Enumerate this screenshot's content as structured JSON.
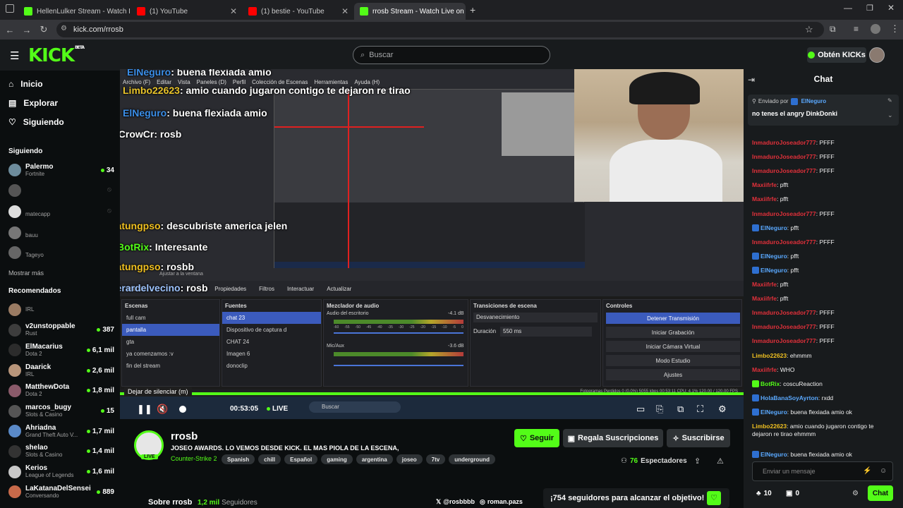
{
  "browser": {
    "tabs": [
      {
        "title": "HellenLulker Stream - Watch Li",
        "fav_color": "#53fc18",
        "active": false
      },
      {
        "title": "(1) YouTube",
        "fav_color": "#ff0000",
        "active": false
      },
      {
        "title": "(1) bestie - YouTube",
        "fav_color": "#ff0000",
        "active": false
      },
      {
        "title": "rrosb Stream - Watch Live on K",
        "fav_color": "#53fc18",
        "active": true
      }
    ],
    "url": "kick.com/rrosb"
  },
  "header": {
    "logo": "KICK",
    "beta": "BETA",
    "search_placeholder": "Buscar",
    "kicks_button": "Obtén KICKs"
  },
  "sidebar": {
    "nav": [
      "Inicio",
      "Explorar",
      "Siguiendo"
    ],
    "following_title": "Siguiendo",
    "following": [
      {
        "name": "Palermo",
        "game": "Fortnite",
        "viewers": "34",
        "color": "#6d8c9c"
      },
      {
        "name": "",
        "game": "",
        "viewers": "",
        "color": "#555"
      },
      {
        "name": "",
        "game": "matecapp",
        "viewers": "",
        "color": "#ddd"
      },
      {
        "name": "",
        "game": "bauu",
        "viewers": "",
        "color": "#777"
      },
      {
        "name": "",
        "game": "Tageyo",
        "viewers": "",
        "color": "#666"
      }
    ],
    "show_more": "Mostrar más",
    "recommended_title": "Recomendados",
    "recommended": [
      {
        "name": "",
        "game": "IRL",
        "viewers": "",
        "color": "#9a7b63"
      },
      {
        "name": "v2unstoppable",
        "game": "Rust",
        "viewers": "387",
        "color": "#3d3d3d"
      },
      {
        "name": "ElMacarius",
        "game": "Dota 2",
        "viewers": "6,1 mil",
        "color": "#2c2c2c"
      },
      {
        "name": "Daarick",
        "game": "IRL",
        "viewers": "2,6 mil",
        "color": "#b8957a"
      },
      {
        "name": "MatthewDota",
        "game": "Dota 2",
        "viewers": "1,8 mil",
        "color": "#8a5a6a"
      },
      {
        "name": "marcos_bugy",
        "game": "Slots & Casino",
        "viewers": "15",
        "color": "#555"
      },
      {
        "name": "Ahriadna",
        "game": "Grand Theft Auto V...",
        "viewers": "1,7 mil",
        "color": "#5a8ac8"
      },
      {
        "name": "shelao",
        "game": "Slots & Casino",
        "viewers": "1,4 mil",
        "color": "#333"
      },
      {
        "name": "Kerios",
        "game": "League of Legends",
        "viewers": "1,6 mil",
        "color": "#c8c8c8"
      },
      {
        "name": "LaKatanaDelSensei",
        "game": "Conversando",
        "viewers": "889",
        "color": "#c86a4a"
      }
    ]
  },
  "video": {
    "overlay_chat": [
      {
        "user": "ElNeguro",
        "text": "buena flexiada amio",
        "color": "#3b8ee8"
      },
      {
        "user": "Limbo22623",
        "text": "amio cuando jugaron contigo te dejaron re tirao",
        "color": "#e8c32a"
      },
      {
        "user": "ElNeguro",
        "text": "buena flexiada amio",
        "color": "#3b8ee8"
      },
      {
        "user": "xCrowCr",
        "text": "rosb",
        "color": "#ffffff"
      },
      {
        "user": "batungpso",
        "text": "descubriste america jelen",
        "color": "#f0c020"
      },
      {
        "user": "BotRix",
        "text": "Interesante",
        "color": "#53fc18"
      },
      {
        "user": "batungpso",
        "text": "rosbb",
        "color": "#f0c020"
      },
      {
        "user": "gerardelvecino",
        "text": "rosb",
        "color": "#9ec4ff"
      }
    ],
    "obs": {
      "menu": [
        "Archivo (F)",
        "Editar",
        "Vista",
        "Paneles (D)",
        "Perfil",
        "Colección de Escenas",
        "Herramientas",
        "Ayuda (H)"
      ],
      "zoom_label": "Ajustar a la ventana",
      "toolbar": [
        "chat 23",
        "Propiedades",
        "Filtros",
        "Interactuar",
        "Actualizar"
      ],
      "scenes_title": "Escenas",
      "scenes": [
        "full cam",
        "pantalla",
        "gta",
        "ya comenzamos :v",
        "fin del stream"
      ],
      "sources_title": "Fuentes",
      "sources": [
        "chat 23",
        "Dispositivo de captura d",
        "CHAT 24",
        "Imagen 6",
        "donoclip"
      ],
      "mixer_title": "Mezclador de audio",
      "mixer": [
        {
          "name": "Audio del escritorio",
          "db": "-4.1 dB"
        },
        {
          "name": "Mic/Aux",
          "db": "-3.6 dB"
        }
      ],
      "mixer_ticks": [
        "-60",
        "-55",
        "-50",
        "-45",
        "-40",
        "-35",
        "-30",
        "-25",
        "-20",
        "-15",
        "-10",
        "-5",
        "0"
      ],
      "transitions_title": "Transiciones de escena",
      "transition_value": "Desvanecimiento",
      "duration_label": "Duración",
      "duration_value": "550 ms",
      "controls_title": "Controles",
      "controls": [
        "Detener Transmisión",
        "Iniciar Grabación",
        "Iniciar Cámara Virtual",
        "Modo Estudio",
        "Ajustes"
      ],
      "status": "Fotogramas Perdidos 0 (0.0%)   5055 kbps   00:53:11   CPU: 4.1%   120.00 / 120.00 FPS",
      "taskbar_search": "Buscar"
    }
  },
  "player": {
    "tooltip": "Dejar de silenciar (m)",
    "time": "00:53:05",
    "live": "LIVE"
  },
  "stream": {
    "channel": "rrosb",
    "title": "JOSEO AWARDS. LO VEMOS DESDE KICK. EL MAS PIOLA DE LA ESCENA,",
    "category": "Counter-Strike 2",
    "tags": [
      "Spanish",
      "chill",
      "Español",
      "gaming",
      "argentina",
      "joseo",
      "7tv",
      "underground"
    ],
    "follow": "Seguir",
    "gift_subs": "Regala Suscripciones",
    "subscribe": "Suscribirse",
    "viewers_count": "76",
    "viewers_label": "Espectadores",
    "about": "Sobre rrosb",
    "followers_count": "1,2 mil",
    "followers_label": "Seguidores",
    "x_handle": "@rosbbbb",
    "ig_handle": "roman.pazs",
    "goal": "¡754 seguidores para alcanzar el objetivo!",
    "live_badge": "LIVE"
  },
  "chat": {
    "title": "Chat",
    "pinned_label": "Enviado por",
    "pinned_user": "ElNeguro",
    "pinned_text": "no tenes el angry DinkDonki",
    "messages": [
      {
        "user": "InmaduroJoseador777",
        "text": "PFFF",
        "color": "#e0303a",
        "badge": ""
      },
      {
        "user": "InmaduroJoseador777",
        "text": "PFFF",
        "color": "#e0303a",
        "badge": ""
      },
      {
        "user": "InmaduroJoseador777",
        "text": "PFFF",
        "color": "#e0303a",
        "badge": ""
      },
      {
        "user": "Maxiifrfe",
        "text": "pfft",
        "color": "#e0303a",
        "badge": ""
      },
      {
        "user": "Maxiifrfe",
        "text": "pfft",
        "color": "#e0303a",
        "badge": ""
      },
      {
        "user": "InmaduroJoseador777",
        "text": "PFFF",
        "color": "#e0303a",
        "badge": ""
      },
      {
        "user": "ElNeguro",
        "text": "pfft",
        "color": "#5aa9ff",
        "badge": "#2e6fd0"
      },
      {
        "user": "InmaduroJoseador777",
        "text": "PFFF",
        "color": "#e0303a",
        "badge": ""
      },
      {
        "user": "ElNeguro",
        "text": "pfft",
        "color": "#5aa9ff",
        "badge": "#2e6fd0"
      },
      {
        "user": "ElNeguro",
        "text": "pfft",
        "color": "#5aa9ff",
        "badge": "#2e6fd0"
      },
      {
        "user": "Maxiifrfe",
        "text": "pfft",
        "color": "#e0303a",
        "badge": ""
      },
      {
        "user": "Maxiifrfe",
        "text": "pfft",
        "color": "#e0303a",
        "badge": ""
      },
      {
        "user": "InmaduroJoseador777",
        "text": "PFFF",
        "color": "#e0303a",
        "badge": ""
      },
      {
        "user": "InmaduroJoseador777",
        "text": "PFFF",
        "color": "#e0303a",
        "badge": ""
      },
      {
        "user": "InmaduroJoseador777",
        "text": "PFFF",
        "color": "#e0303a",
        "badge": ""
      },
      {
        "user": "Limbo22623",
        "text": "ehmmm",
        "color": "#f0c020",
        "badge": ""
      },
      {
        "user": "Maxiifrfe",
        "text": "WHO",
        "color": "#e0303a",
        "badge": ""
      },
      {
        "user": "BotRix",
        "text": "coscuReaction",
        "color": "#53fc18",
        "badge": "#53fc18"
      },
      {
        "user": "HolaBanaSoyAyrton",
        "text": "rxdd",
        "color": "#5aa9ff",
        "badge": "#2e6fd0"
      },
      {
        "user": "ElNeguro",
        "text": "buena flexiada amio ok",
        "color": "#5aa9ff",
        "badge": "#2e6fd0"
      },
      {
        "user": "Limbo22623",
        "text": "amio cuando jugaron contigo te",
        "color": "#f0c020",
        "badge": ""
      },
      {
        "user": "",
        "text": "dejaron re tirao ehmmm",
        "color": "#f0c020",
        "badge": ""
      },
      {
        "user": "ElNeguro",
        "text": "buena flexiada amio ok",
        "color": "#5aa9ff",
        "badge": "#2e6fd0"
      }
    ],
    "input_placeholder": "Enviar un mensaje",
    "points": "10",
    "gifts": "0",
    "send_button": "Chat"
  },
  "colors": {
    "accent": "#53fc18",
    "bg": "#0b0e0f",
    "panel": "#181b1d"
  }
}
